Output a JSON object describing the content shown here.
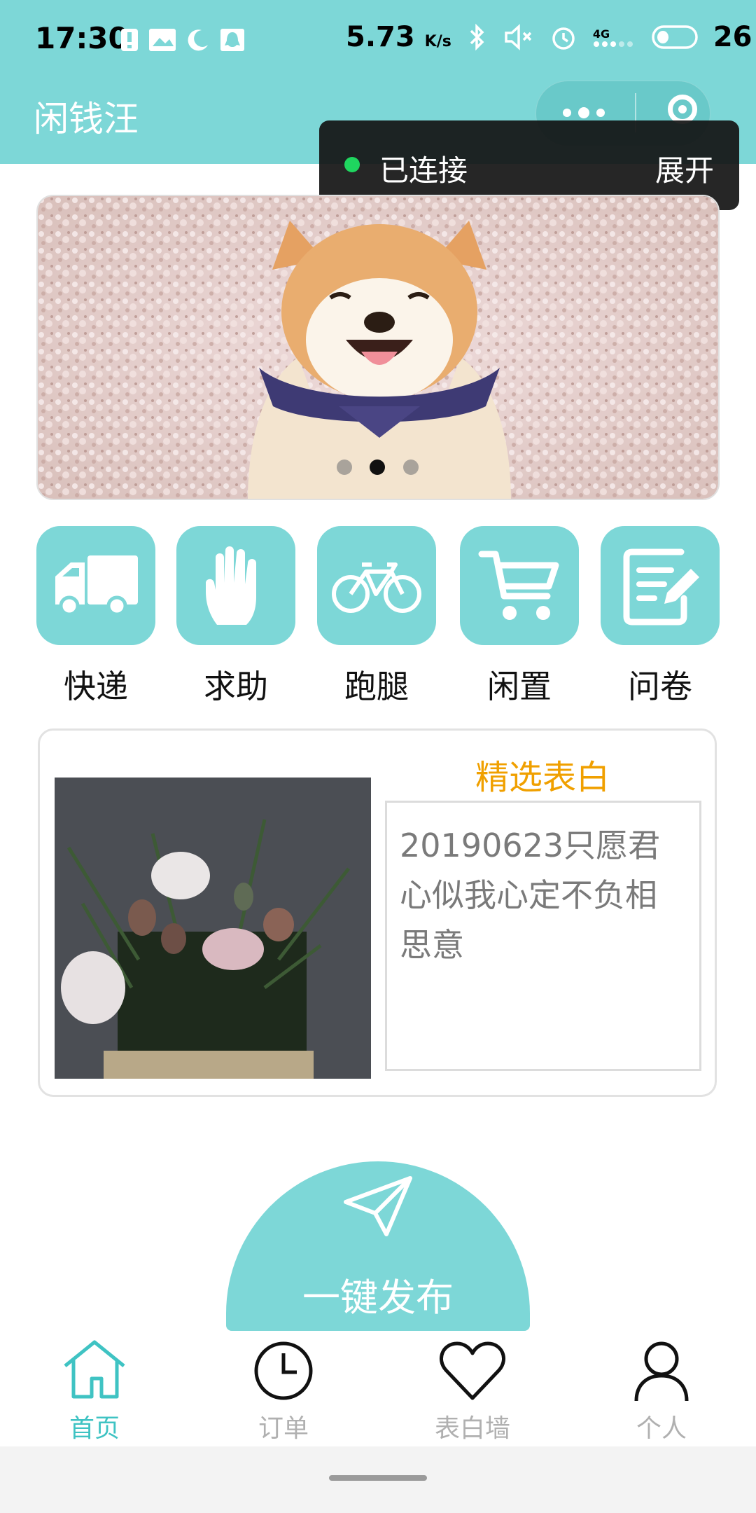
{
  "status_bar": {
    "time": "17:30",
    "network_speed": "5.73",
    "network_speed_unit": "K/s",
    "signal_label": "4G",
    "battery": "26"
  },
  "header": {
    "app_title": "闲钱汪",
    "accent_color": "#7dd7d7"
  },
  "connection_popup": {
    "status": "已连接",
    "expand_label": "展开",
    "status_color": "#1fd65f"
  },
  "banner": {
    "image_subject": "shiba-inu-dog-photo",
    "dots_count": 3,
    "active_dot": 1
  },
  "categories": [
    {
      "label": "快递",
      "icon": "truck-icon"
    },
    {
      "label": "求助",
      "icon": "hand-icon"
    },
    {
      "label": "跑腿",
      "icon": "bicycle-icon"
    },
    {
      "label": "闲置",
      "icon": "cart-icon"
    },
    {
      "label": "问卷",
      "icon": "edit-note-icon"
    }
  ],
  "featured": {
    "heading": "精选表白",
    "heading_color": "#f0a000",
    "message": "20190623只愿君心似我心定不负相思意",
    "image_subject": "flower-bouquet-photo"
  },
  "publish": {
    "label": "一键发布",
    "icon": "paper-plane-icon"
  },
  "tabbar": {
    "items": [
      {
        "label": "首页",
        "icon": "home-icon",
        "active": true
      },
      {
        "label": "订单",
        "icon": "clock-icon",
        "active": false
      },
      {
        "label": "表白墙",
        "icon": "heart-icon",
        "active": false
      },
      {
        "label": "个人",
        "icon": "person-icon",
        "active": false
      }
    ],
    "active_color": "#3fc3c3",
    "inactive_color": "#b0b0b0"
  }
}
